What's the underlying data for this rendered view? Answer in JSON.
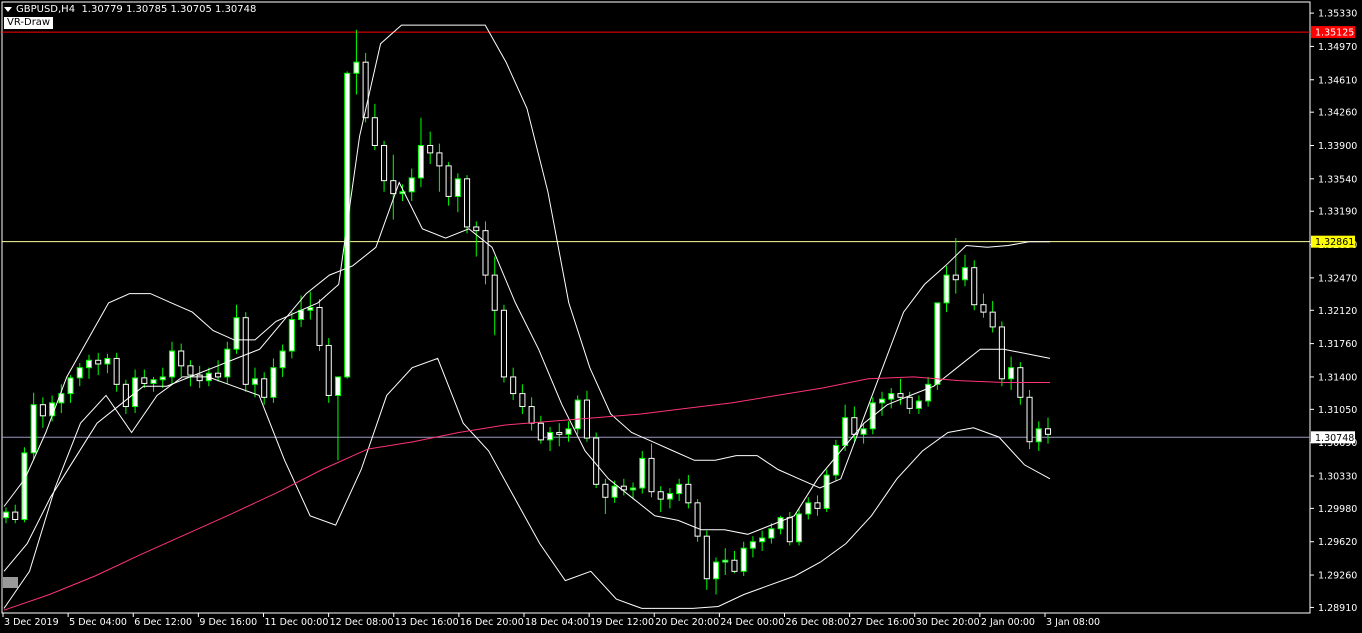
{
  "header": {
    "symbol": "GBPUSD,H4",
    "ohlc": "1.30779 1.30785 1.30705 1.30748"
  },
  "indicator_label": "VR-Draw",
  "price_axis": {
    "ticks": [
      "1.35330",
      "1.34970",
      "1.34610",
      "1.34260",
      "1.33900",
      "1.33540",
      "1.33190",
      "1.32830",
      "1.32470",
      "1.32120",
      "1.31760",
      "1.31400",
      "1.31050",
      "1.30690",
      "1.30330",
      "1.29980",
      "1.29620",
      "1.29260",
      "1.28910"
    ],
    "tags": [
      {
        "label": "1.35125",
        "price": 1.35125,
        "bg": "#ff0000",
        "fg": "#ffffff",
        "line": "#ff0000"
      },
      {
        "label": "1.32861",
        "price": 1.32861,
        "bg": "#ffff00",
        "fg": "#000000",
        "line": "#ffff99"
      },
      {
        "label": "1.30748",
        "price": 1.30748,
        "bg": "#ffffff",
        "fg": "#000000",
        "line": "#9a9ac0"
      }
    ]
  },
  "time_axis": {
    "labels": [
      "3 Dec 2019",
      "5 Dec 04:00",
      "6 Dec 12:00",
      "9 Dec 16:00",
      "11 Dec 00:00",
      "12 Dec 08:00",
      "13 Dec 16:00",
      "16 Dec 20:00",
      "18 Dec 04:00",
      "19 Dec 12:00",
      "20 Dec 20:00",
      "24 Dec 00:00",
      "26 Dec 08:00",
      "27 Dec 16:00",
      "30 Dec 20:00",
      "2 Jan 00:00",
      "3 Jan 08:00"
    ]
  },
  "colors": {
    "background": "#000000",
    "bull_candle": "#ffffff",
    "candle_wick": "#00ff00",
    "bollinger": "#ffffff",
    "moving_average": "#ff3377",
    "axis": "#ffffff"
  },
  "chart_data": {
    "type": "candlestick",
    "symbol": "GBPUSD",
    "timeframe": "H4",
    "ylim": [
      1.2885,
      1.3545
    ],
    "candles": [
      [
        1.2988,
        1.2999,
        1.2982,
        1.2994
      ],
      [
        1.2994,
        1.3002,
        1.2982,
        1.2986
      ],
      [
        1.2986,
        1.3064,
        1.2983,
        1.3058
      ],
      [
        1.3058,
        1.3123,
        1.305,
        1.311
      ],
      [
        1.311,
        1.3118,
        1.3085,
        1.3098
      ],
      [
        1.3098,
        1.312,
        1.3092,
        1.3112
      ],
      [
        1.3112,
        1.3132,
        1.3101,
        1.3122
      ],
      [
        1.3122,
        1.3142,
        1.3112,
        1.3139
      ],
      [
        1.3139,
        1.3155,
        1.313,
        1.315
      ],
      [
        1.315,
        1.3164,
        1.3138,
        1.3158
      ],
      [
        1.3158,
        1.3166,
        1.3142,
        1.3154
      ],
      [
        1.3154,
        1.3165,
        1.3144,
        1.316
      ],
      [
        1.316,
        1.3166,
        1.3124,
        1.3132
      ],
      [
        1.3132,
        1.3137,
        1.31,
        1.3108
      ],
      [
        1.3108,
        1.3148,
        1.3101,
        1.3139
      ],
      [
        1.3139,
        1.3148,
        1.3128,
        1.3133
      ],
      [
        1.3133,
        1.314,
        1.3124,
        1.3137
      ],
      [
        1.3137,
        1.315,
        1.3128,
        1.314
      ],
      [
        1.314,
        1.3178,
        1.3132,
        1.3168
      ],
      [
        1.3168,
        1.3176,
        1.314,
        1.3152
      ],
      [
        1.3152,
        1.3158,
        1.313,
        1.3142
      ],
      [
        1.3142,
        1.3152,
        1.3128,
        1.3136
      ],
      [
        1.3136,
        1.315,
        1.313,
        1.3144
      ],
      [
        1.3144,
        1.3158,
        1.3135,
        1.314
      ],
      [
        1.314,
        1.3178,
        1.3132,
        1.317
      ],
      [
        1.317,
        1.3218,
        1.3165,
        1.3204
      ],
      [
        1.3204,
        1.321,
        1.3124,
        1.3132
      ],
      [
        1.3132,
        1.315,
        1.3118,
        1.3138
      ],
      [
        1.3138,
        1.3145,
        1.311,
        1.3118
      ],
      [
        1.3118,
        1.316,
        1.3112,
        1.315
      ],
      [
        1.315,
        1.3175,
        1.314,
        1.3168
      ],
      [
        1.3168,
        1.321,
        1.316,
        1.3202
      ],
      [
        1.3202,
        1.3228,
        1.3194,
        1.3212
      ],
      [
        1.3212,
        1.3232,
        1.3202,
        1.3215
      ],
      [
        1.3215,
        1.3224,
        1.3168,
        1.3174
      ],
      [
        1.3174,
        1.3182,
        1.3112,
        1.312
      ],
      [
        1.312,
        1.3135,
        1.305,
        1.314
      ],
      [
        1.314,
        1.347,
        1.3138,
        1.3468
      ],
      [
        1.3468,
        1.3515,
        1.3445,
        1.348
      ],
      [
        1.348,
        1.349,
        1.3415,
        1.342
      ],
      [
        1.342,
        1.3435,
        1.3385,
        1.339
      ],
      [
        1.339,
        1.3395,
        1.334,
        1.3352
      ],
      [
        1.3352,
        1.338,
        1.331,
        1.3338
      ],
      [
        1.3338,
        1.3348,
        1.333,
        1.334
      ],
      [
        1.334,
        1.3365,
        1.333,
        1.3355
      ],
      [
        1.3355,
        1.342,
        1.3345,
        1.339
      ],
      [
        1.339,
        1.3405,
        1.337,
        1.3382
      ],
      [
        1.3382,
        1.3392,
        1.334,
        1.3368
      ],
      [
        1.3368,
        1.3372,
        1.3325,
        1.3335
      ],
      [
        1.3335,
        1.336,
        1.3318,
        1.3354
      ],
      [
        1.3354,
        1.3358,
        1.3295,
        1.3302
      ],
      [
        1.3302,
        1.3308,
        1.327,
        1.3298
      ],
      [
        1.3298,
        1.3308,
        1.324,
        1.325
      ],
      [
        1.325,
        1.327,
        1.3185,
        1.3212
      ],
      [
        1.3212,
        1.3218,
        1.3134,
        1.314
      ],
      [
        1.314,
        1.315,
        1.3115,
        1.3122
      ],
      [
        1.3122,
        1.3132,
        1.31,
        1.3108
      ],
      [
        1.3108,
        1.3118,
        1.3082,
        1.309
      ],
      [
        1.309,
        1.3098,
        1.3068,
        1.3072
      ],
      [
        1.3072,
        1.3086,
        1.306,
        1.308
      ],
      [
        1.308,
        1.309,
        1.3065,
        1.3078
      ],
      [
        1.3078,
        1.3092,
        1.307,
        1.3084
      ],
      [
        1.3084,
        1.312,
        1.3078,
        1.3115
      ],
      [
        1.3115,
        1.3125,
        1.307,
        1.3074
      ],
      [
        1.3074,
        1.308,
        1.302,
        1.3024
      ],
      [
        1.3024,
        1.303,
        1.2992,
        1.301
      ],
      [
        1.301,
        1.3028,
        1.3004,
        1.3022
      ],
      [
        1.3022,
        1.303,
        1.3012,
        1.3018
      ],
      [
        1.3018,
        1.3026,
        1.3008,
        1.302
      ],
      [
        1.302,
        1.306,
        1.3014,
        1.3052
      ],
      [
        1.3052,
        1.3068,
        1.301,
        1.3016
      ],
      [
        1.3016,
        1.3022,
        1.2994,
        1.3008
      ],
      [
        1.3008,
        1.302,
        1.2998,
        1.3014
      ],
      [
        1.3014,
        1.303,
        1.3006,
        1.3024
      ],
      [
        1.3024,
        1.3034,
        1.2998,
        1.3004
      ],
      [
        1.3004,
        1.3008,
        1.2962,
        1.2968
      ],
      [
        1.2968,
        1.2974,
        1.291,
        1.2922
      ],
      [
        1.2922,
        1.2945,
        1.2905,
        1.294
      ],
      [
        1.294,
        1.2955,
        1.2926,
        1.2942
      ],
      [
        1.2942,
        1.2952,
        1.2928,
        1.293
      ],
      [
        1.293,
        1.2962,
        1.2925,
        1.2955
      ],
      [
        1.2955,
        1.2968,
        1.2945,
        1.2962
      ],
      [
        1.2962,
        1.2974,
        1.2952,
        1.2966
      ],
      [
        1.2966,
        1.2982,
        1.296,
        1.2976
      ],
      [
        1.2976,
        1.299,
        1.297,
        1.2988
      ],
      [
        1.2988,
        1.2994,
        1.2958,
        1.2962
      ],
      [
        1.2962,
        1.2998,
        1.2958,
        1.2992
      ],
      [
        1.2992,
        1.301,
        1.2986,
        1.3004
      ],
      [
        1.3004,
        1.3012,
        1.299,
        1.2998
      ],
      [
        1.2998,
        1.304,
        1.2994,
        1.3034
      ],
      [
        1.3034,
        1.3072,
        1.3028,
        1.3066
      ],
      [
        1.3066,
        1.311,
        1.306,
        1.3096
      ],
      [
        1.3096,
        1.3108,
        1.307,
        1.3078
      ],
      [
        1.3078,
        1.309,
        1.3068,
        1.3084
      ],
      [
        1.3084,
        1.3118,
        1.3078,
        1.3112
      ],
      [
        1.3112,
        1.3124,
        1.3098,
        1.3116
      ],
      [
        1.3116,
        1.3128,
        1.3106,
        1.3122
      ],
      [
        1.3122,
        1.3138,
        1.311,
        1.3118
      ],
      [
        1.3118,
        1.3124,
        1.31,
        1.3106
      ],
      [
        1.3106,
        1.312,
        1.31,
        1.3114
      ],
      [
        1.3114,
        1.314,
        1.3108,
        1.3132
      ],
      [
        1.3132,
        1.3176,
        1.3126,
        1.322
      ],
      [
        1.322,
        1.326,
        1.321,
        1.325
      ],
      [
        1.325,
        1.329,
        1.323,
        1.3245
      ],
      [
        1.3245,
        1.3272,
        1.3238,
        1.3258
      ],
      [
        1.3258,
        1.3266,
        1.3212,
        1.3218
      ],
      [
        1.3218,
        1.323,
        1.3204,
        1.321
      ],
      [
        1.321,
        1.3222,
        1.3188,
        1.3194
      ],
      [
        1.3194,
        1.32,
        1.313,
        1.3138
      ],
      [
        1.3138,
        1.3162,
        1.3126,
        1.315
      ],
      [
        1.315,
        1.3156,
        1.311,
        1.3118
      ],
      [
        1.3118,
        1.3126,
        1.3062,
        1.307
      ],
      [
        1.307,
        1.3092,
        1.306,
        1.3084
      ],
      [
        1.3084,
        1.3096,
        1.3068,
        1.3078
      ]
    ],
    "bollinger_upper": [
      1.3,
      1.303,
      1.308,
      1.314,
      1.318,
      1.322,
      1.323,
      1.323,
      1.322,
      1.321,
      1.319,
      1.318,
      1.318,
      1.32,
      1.321,
      1.322,
      1.324,
      1.34,
      1.35,
      1.352,
      1.352,
      1.352,
      1.352,
      1.352,
      1.348,
      1.343,
      1.334,
      1.322,
      1.315,
      1.31,
      1.308,
      1.307,
      1.306,
      1.305,
      1.305,
      1.3055,
      1.3055,
      1.304,
      1.303,
      1.302,
      1.303,
      1.309,
      1.315,
      1.321,
      1.324,
      1.326,
      1.3282,
      1.328,
      1.3282,
      1.3286,
      1.3286
    ],
    "bollinger_middle": [
      1.293,
      1.296,
      1.301,
      1.305,
      1.309,
      1.311,
      1.313,
      1.313,
      1.314,
      1.315,
      1.316,
      1.317,
      1.32,
      1.323,
      1.325,
      1.326,
      1.328,
      1.335,
      1.33,
      1.329,
      1.33,
      1.328,
      1.322,
      1.317,
      1.311,
      1.306,
      1.303,
      1.301,
      1.299,
      1.2985,
      1.2975,
      1.2975,
      1.297,
      1.298,
      1.299,
      1.303,
      1.306,
      1.309,
      1.311,
      1.312,
      1.313,
      1.315,
      1.317,
      1.317,
      1.3165,
      1.316
    ],
    "bollinger_lower": [
      1.289,
      1.293,
      1.302,
      1.309,
      1.312,
      1.308,
      1.312,
      1.314,
      1.314,
      1.313,
      1.312,
      1.305,
      1.299,
      1.298,
      1.304,
      1.312,
      1.315,
      1.316,
      1.309,
      1.306,
      1.301,
      1.296,
      1.292,
      1.293,
      1.29,
      1.289,
      1.289,
      1.289,
      1.2892,
      1.2905,
      1.2915,
      1.2925,
      1.294,
      1.296,
      1.299,
      1.303,
      1.306,
      1.308,
      1.3085,
      1.3075,
      1.3045,
      1.303
    ],
    "moving_average": [
      1.2888,
      1.2905,
      1.2925,
      1.2948,
      1.297,
      1.2992,
      1.3015,
      1.304,
      1.3062,
      1.307,
      1.308,
      1.3088,
      1.3092,
      1.3096,
      1.31,
      1.3106,
      1.3112,
      1.312,
      1.3128,
      1.3138,
      1.314,
      1.3136,
      1.3134,
      1.3134
    ],
    "horizontal_lines": [
      1.35125,
      1.32861,
      1.30748
    ]
  }
}
